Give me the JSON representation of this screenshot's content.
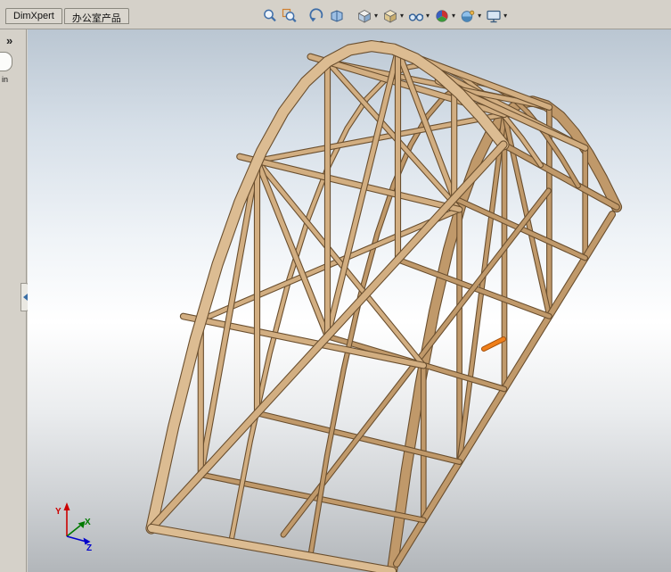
{
  "window": {
    "chrome_color": "#d5d1c9"
  },
  "command_tabs": [
    {
      "label": "DimXpert"
    },
    {
      "label": "办公室产品"
    }
  ],
  "view_toolbar": {
    "items": [
      "zoom-to-fit",
      "zoom-to-area",
      "previous-view",
      "3d-drawing-view",
      "view-orientation",
      "display-style",
      "hide-show-items",
      "edit-appearance",
      "apply-scene",
      "view-settings"
    ],
    "dropdown_glyph": "▾"
  },
  "left_panel": {
    "expand_glyph": "»",
    "unit_label": "in"
  },
  "viewport": {
    "triad_labels": {
      "x": "X",
      "y": "Y",
      "z": "Z"
    },
    "selection_highlight": "#f07f1a"
  },
  "model": {
    "name": "wooden-arch-bridge-frame",
    "wood_light": "#dcbc92",
    "wood": "#d2ae81",
    "wood_shade": "#c0996a",
    "wood_edge": "#6a4f2f"
  }
}
